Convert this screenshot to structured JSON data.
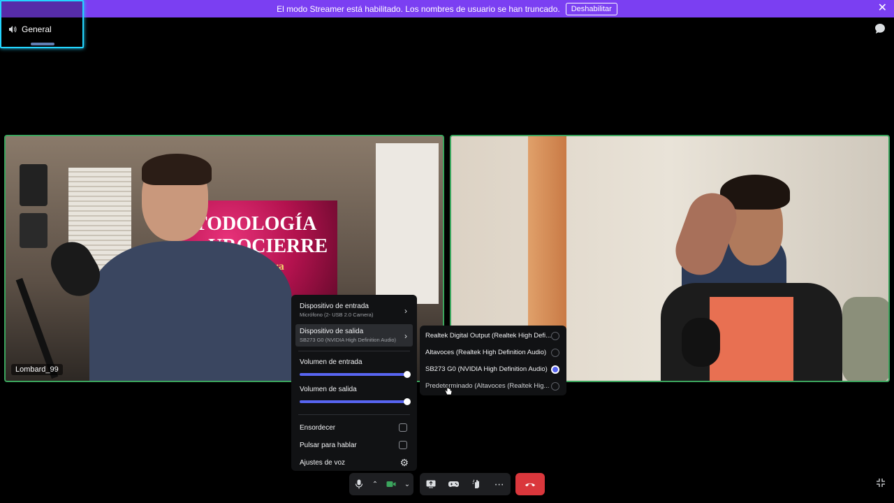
{
  "banner": {
    "message": "El modo Streamer está habilitado. Los nombres de usuario se han truncado.",
    "disable_label": "Deshabilitar",
    "close_icon": "close-icon",
    "color": "#7b3ff2"
  },
  "channel": {
    "name": "General",
    "icon": "speaker-icon"
  },
  "tiles": [
    {
      "name": "Lombard_99",
      "border_color": "#3ba55d",
      "poster_text": [
        "TODOLOGÍA",
        "UROCIERRE",
        "Lara"
      ]
    },
    {
      "name": "",
      "border_color": "#3ba55d"
    }
  ],
  "voice_menu": {
    "input_device_title": "Dispositivo de entrada",
    "input_device_value": "Micrófono (2- USB 2.0 Camera)",
    "output_device_title": "Dispositivo de salida",
    "output_device_value": "SB273 G0 (NVIDIA High Definition Audio)",
    "input_volume_label": "Volumen de entrada",
    "input_volume": 100,
    "output_volume_label": "Volumen de salida",
    "output_volume": 100,
    "deafen_label": "Ensordecer",
    "push_to_talk_label": "Pulsar para hablar",
    "voice_settings_label": "Ajustes de voz",
    "accent_color": "#5865f2"
  },
  "output_devices": [
    {
      "label": "Realtek Digital Output (Realtek High Defi...",
      "selected": false
    },
    {
      "label": "Altavoces (Realtek High Definition Audio)",
      "selected": false
    },
    {
      "label": "SB273 G0 (NVIDIA High Definition Audio)",
      "selected": true
    },
    {
      "label": "Predeterminado (Altavoces (Realtek Hig...",
      "selected": false
    }
  ],
  "controls": {
    "icons": [
      "microphone-icon",
      "chevron-up-icon",
      "camera-icon",
      "chevron-down-icon",
      "screen-share-icon",
      "activity-icon",
      "soundboard-icon",
      "more-icon",
      "hang-up-icon"
    ],
    "hangup_color": "#da373c"
  }
}
